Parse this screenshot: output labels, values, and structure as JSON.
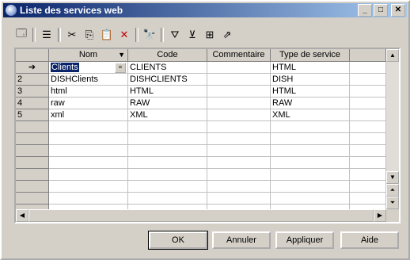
{
  "window": {
    "title": "Liste des services web"
  },
  "toolbar": {
    "buttons": [
      {
        "name": "properties-icon",
        "glyph": "🗔"
      },
      {
        "name": "add-row-icon",
        "glyph": "☰"
      },
      {
        "name": "cut-icon",
        "glyph": "✂"
      },
      {
        "name": "copy-icon",
        "glyph": "⎘"
      },
      {
        "name": "paste-icon",
        "glyph": "📋"
      },
      {
        "name": "delete-icon",
        "glyph": "✕"
      },
      {
        "name": "find-icon",
        "glyph": "🔭"
      },
      {
        "name": "filter-icon",
        "glyph": "⛛"
      },
      {
        "name": "filter-settings-icon",
        "glyph": "⊻"
      },
      {
        "name": "tree-icon",
        "glyph": "⊞"
      },
      {
        "name": "goto-icon",
        "glyph": "⇗"
      }
    ]
  },
  "grid": {
    "columns": [
      "Nom",
      "Code",
      "Commentaire",
      "Type de service"
    ],
    "rows": [
      {
        "header": "➔",
        "nom": "Clients",
        "code": "CLIENTS",
        "commentaire": "",
        "type": "HTML"
      },
      {
        "header": "2",
        "nom": "DISHClients",
        "code": "DISHCLIENTS",
        "commentaire": "",
        "type": "DISH"
      },
      {
        "header": "3",
        "nom": "html",
        "code": "HTML",
        "commentaire": "",
        "type": "HTML"
      },
      {
        "header": "4",
        "nom": "raw",
        "code": "RAW",
        "commentaire": "",
        "type": "RAW"
      },
      {
        "header": "5",
        "nom": "xml",
        "code": "XML",
        "commentaire": "",
        "type": "XML"
      }
    ],
    "empty_rows": 8
  },
  "buttons": {
    "ok": "OK",
    "cancel": "Annuler",
    "apply": "Appliquer",
    "help": "Aide"
  },
  "colors": {
    "titlebar": "#0a246a",
    "selection": "#0a246a",
    "face": "#d4d0c8"
  }
}
